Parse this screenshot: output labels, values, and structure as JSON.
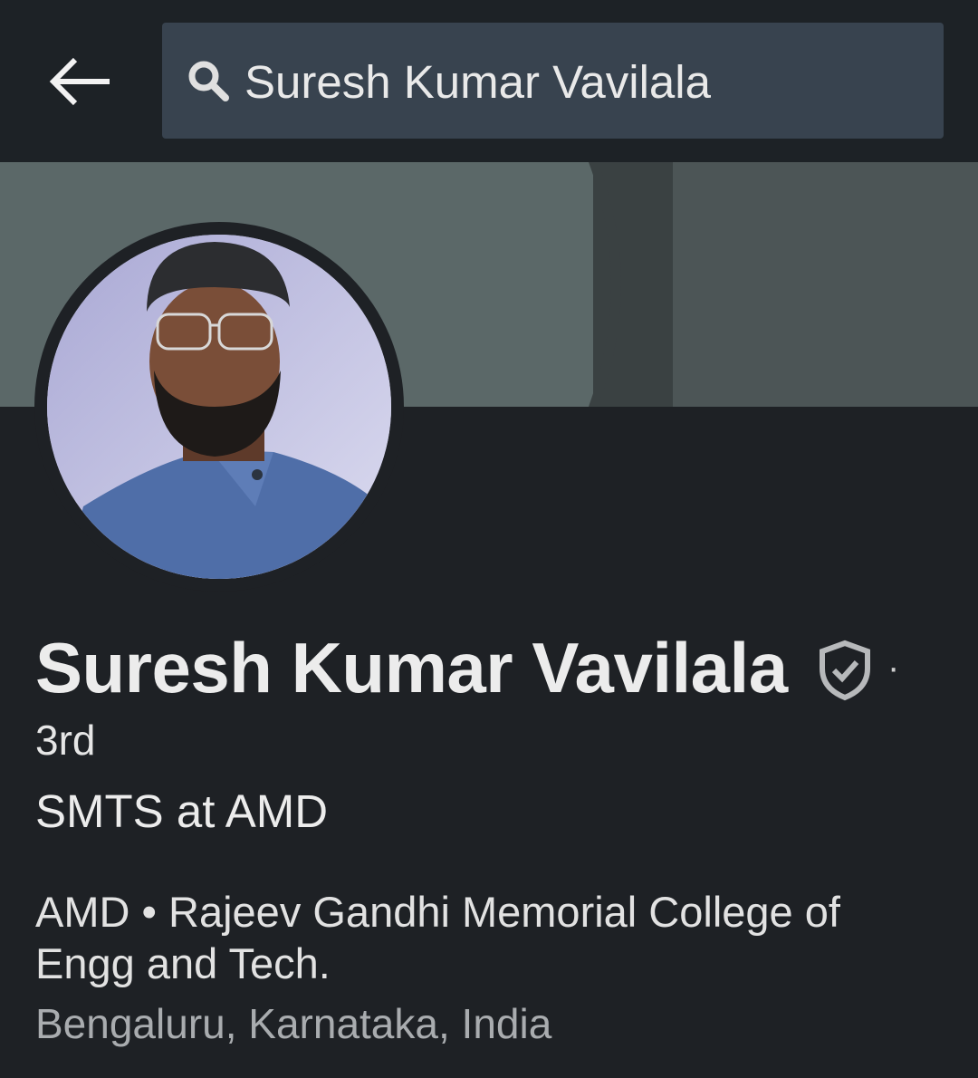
{
  "colors": {
    "background": "#1e2125",
    "search_bg": "#38434f",
    "banner": "#4c5556",
    "text_primary": "#ececec",
    "text_secondary": "#a9acaf"
  },
  "header": {
    "back_icon": "arrow-left-icon",
    "search": {
      "icon": "search-icon",
      "value": "Suresh Kumar Vavilala"
    }
  },
  "profile": {
    "name": "Suresh Kumar Vavilala",
    "badge_icon": "verified-shield-icon",
    "separator": "·",
    "degree": "3rd",
    "headline": "SMTS at AMD",
    "organizations": "AMD • Rajeev Gandhi Memorial College of Engg and Tech.",
    "location": "Bengaluru, Karnataka, India"
  }
}
